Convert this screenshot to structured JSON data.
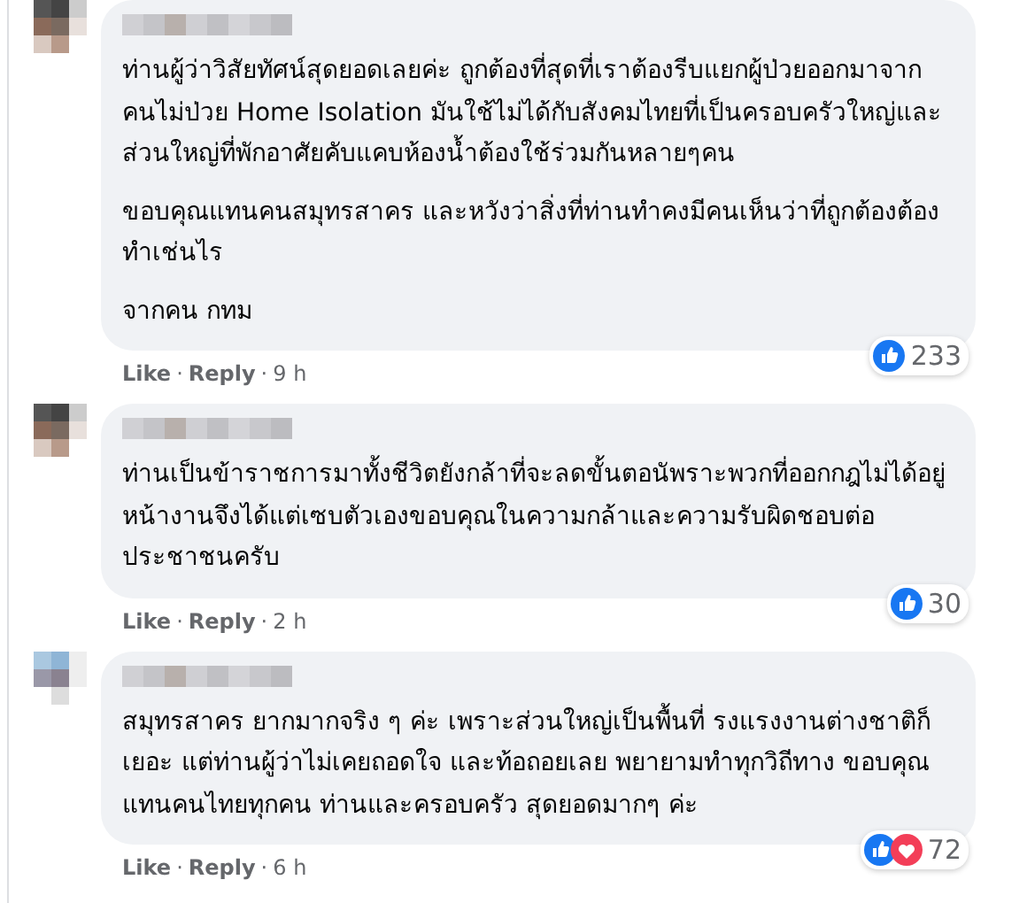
{
  "comments": [
    {
      "paragraphs": [
        "ท่านผู้ว่าวิสัยทัศน์สุดยอดเลยค่ะ ถูกต้องที่สุดที่เราต้องรีบแยกผู้ป่วยออกมาจากคนไม่ป่วย Home Isolation มันใช้ไม่ได้กับสังคมไทยที่เป็นครอบครัวใหญ่และส่วนใหญ่ที่พักอาศัยคับแคบห้องน้ำต้องใช้ร่วมกันหลายๆคน",
        "ขอบคุณแทนคนสมุทรสาคร และหวังว่าสิ่งที่ท่านทำคงมีคนเห็นว่าที่ถูกต้องต้องทำเช่นไร",
        "จากคน กทม"
      ],
      "actions": [
        "Like",
        "Reply"
      ],
      "separator": "·",
      "time": "9 h",
      "reactions": [
        {
          "kind": "like"
        }
      ],
      "reaction_count": "233"
    },
    {
      "paragraphs": [
        "ท่านเป็นข้าราชการมาทั้งชีวิตยังกล้าที่จะลดขั้นตอนัพราะพวกที่ออกกฎไม่ได้อยู่หน้างานจึงได้แต่เซบตัวเองขอบคุณในความกล้าและความรับผิดชอบต่อประชาชนครับ"
      ],
      "actions": [
        "Like",
        "Reply"
      ],
      "separator": "·",
      "time": "2 h",
      "reactions": [
        {
          "kind": "like"
        }
      ],
      "reaction_count": "30"
    },
    {
      "paragraphs": [
        "สมุทรสาคร ยากมากจริง ๆ ค่ะ เพราะส่วนใหญ่เป็นพื้นที่ รงแรงงานต่างชาติก็เยอะ แต่ท่านผู้ว่าไม่เคยถอดใจ และท้อถอยเลย พยายามทำทุกวิถีทาง ขอบคุณแทนคนไทยทุกคน ท่านและครอบครัว สุดยอดมากๆ ค่ะ"
      ],
      "actions": [
        "Like",
        "Reply"
      ],
      "separator": "·",
      "time": "6 h",
      "reactions": [
        {
          "kind": "like"
        },
        {
          "kind": "love"
        }
      ],
      "reaction_count": "72"
    }
  ]
}
